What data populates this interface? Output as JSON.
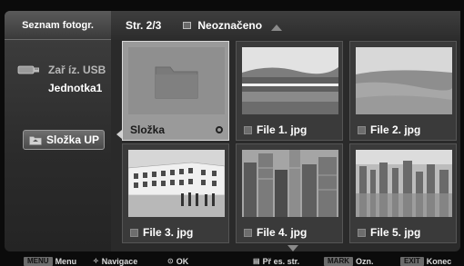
{
  "sidebar": {
    "title": "Seznam fotogr.",
    "device_label": "Zař íz. USB",
    "drive_label": "Jednotka1",
    "folder_up_label": "Složka UP"
  },
  "header": {
    "page_counter": "Str. 2/3",
    "filter_label": "Neoznačeno"
  },
  "tiles": [
    {
      "label": "Složka",
      "type": "folder",
      "selected": true
    },
    {
      "label": "File 1. jpg",
      "type": "photo",
      "icon": "dam-photo"
    },
    {
      "label": "File 2. jpg",
      "type": "photo",
      "icon": "coast-photo"
    },
    {
      "label": "File 3. jpg",
      "type": "photo",
      "icon": "building-photo"
    },
    {
      "label": "File 4. jpg",
      "type": "photo",
      "icon": "city-photo"
    },
    {
      "label": "File 5. jpg",
      "type": "photo",
      "icon": "cityscape-photo"
    }
  ],
  "footer": {
    "menu_key": "MENU",
    "menu_label": "Menu",
    "nav_label": "Navigace",
    "ok_label": "OK",
    "page_label": "Př es. str.",
    "mark_key": "MARK",
    "mark_label": "Ozn.",
    "exit_key": "EXIT",
    "exit_label": "Konec"
  },
  "colors": {
    "panel": "#2a2a2a",
    "selected_tile": "#9a9a9a"
  }
}
